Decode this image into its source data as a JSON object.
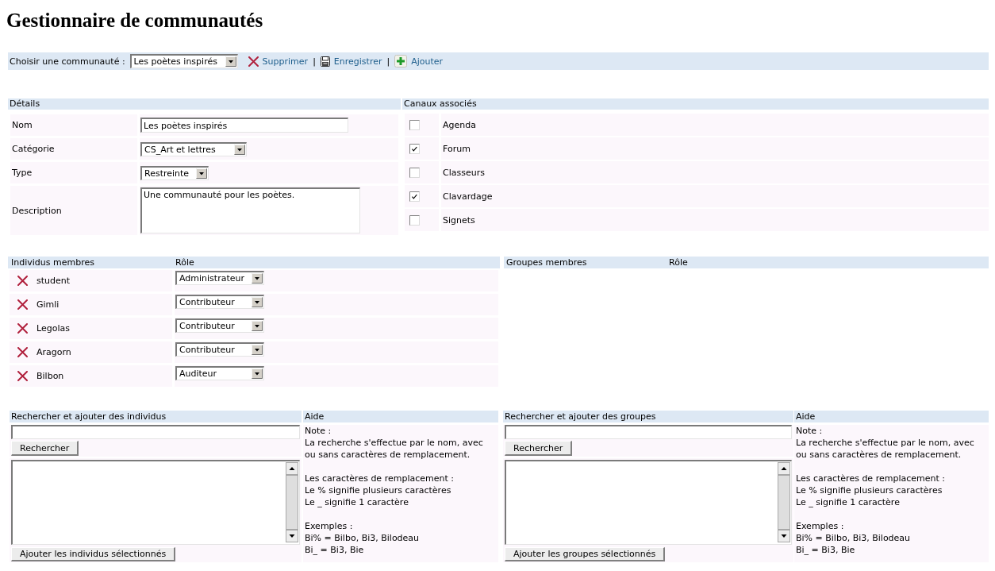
{
  "page": {
    "title": "Gestionnaire de communautés"
  },
  "toolbar": {
    "label": "Choisir une communauté :",
    "selected_community": "Les poètes inspirés",
    "separator": "|",
    "actions": [
      {
        "kind": "delete",
        "label": "Supprimer"
      },
      {
        "kind": "save",
        "label": "Enregistrer"
      },
      {
        "kind": "add",
        "label": "Ajouter"
      }
    ]
  },
  "details": {
    "heading": "Détails",
    "fields": [
      {
        "kind": "text",
        "label": "Nom",
        "value": "Les poètes inspirés"
      },
      {
        "kind": "select",
        "label": "Catégorie",
        "value": "CS_Art et lettres"
      },
      {
        "kind": "select",
        "label": "Type",
        "value": "Restreinte"
      },
      {
        "kind": "textarea",
        "label": "Description",
        "value": "Une communauté pour les poètes."
      }
    ]
  },
  "channels": {
    "heading": "Canaux associés",
    "items": [
      {
        "label": "Agenda",
        "checked": false
      },
      {
        "label": "Forum",
        "checked": true
      },
      {
        "label": "Classeurs",
        "checked": false
      },
      {
        "label": "Clavardage",
        "checked": true
      },
      {
        "label": "Signets",
        "checked": false
      }
    ]
  },
  "members": {
    "columns": [
      "Individus membres",
      "Rôle"
    ],
    "rows": [
      {
        "name": "student",
        "role": "Administrateur"
      },
      {
        "name": "Gimli",
        "role": "Contributeur"
      },
      {
        "name": "Legolas",
        "role": "Contributeur"
      },
      {
        "name": "Aragorn",
        "role": "Contributeur"
      },
      {
        "name": "Bilbon",
        "role": "Auditeur"
      }
    ]
  },
  "groups": {
    "columns": [
      "Groupes membres",
      "Rôle"
    ]
  },
  "searches": [
    {
      "heading": "Rechercher et ajouter des individus",
      "search_button": "Rechercher",
      "add_button": "Ajouter les individus sélectionnés",
      "help_heading": "Aide",
      "help": [
        [
          "Note :",
          "La recherche s'effectue par le nom, avec ou sans caractères de remplacement."
        ],
        [
          "Les caractères de remplacement :",
          "Le % signifie plusieurs caractères",
          "Le _ signifie 1 caractère"
        ],
        [
          "Exemples :",
          "Bi% = Bilbo, Bi3, Bilodeau",
          "Bi_ = Bi3, Bie"
        ]
      ]
    },
    {
      "heading": "Rechercher et ajouter des groupes",
      "search_button": "Rechercher",
      "add_button": "Ajouter les groupes sélectionnés",
      "help_heading": "Aide",
      "help": [
        [
          "Note :",
          "La recherche s'effectue par le nom, avec ou sans caractères de remplacement."
        ],
        [
          "Les caractères de remplacement :",
          "Le % signifie plusieurs caractères",
          "Le _ signifie 1 caractère"
        ],
        [
          "Exemples :",
          "Bi% = Bilbo, Bi3, Bilodeau",
          "Bi_ = Bi3, Bie"
        ]
      ]
    }
  ]
}
